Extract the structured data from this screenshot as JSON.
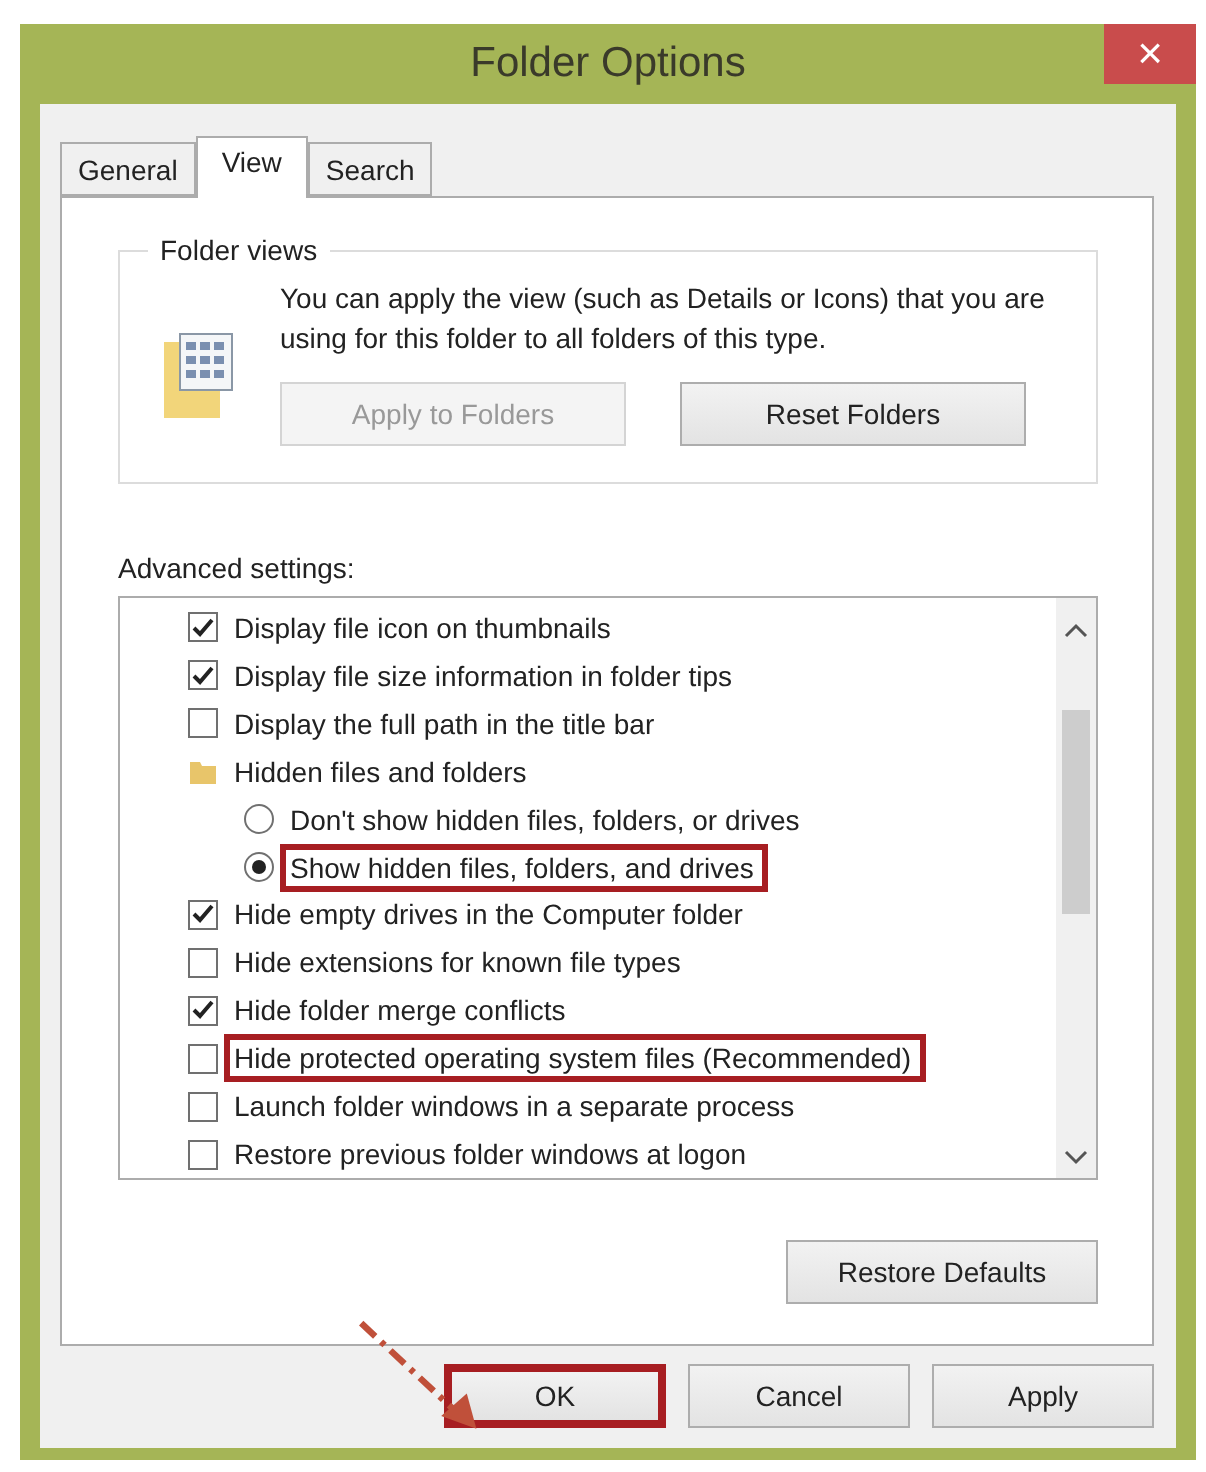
{
  "window": {
    "title": "Folder Options",
    "close": "×"
  },
  "tabs": [
    {
      "label": "General",
      "selected": false
    },
    {
      "label": "View",
      "selected": true
    },
    {
      "label": "Search",
      "selected": false
    }
  ],
  "folder_views": {
    "legend": "Folder views",
    "description": "You can apply the view (such as Details or Icons) that you are using for this folder to all folders of this type.",
    "buttons": [
      {
        "label": "Apply to Folders",
        "disabled": true
      },
      {
        "label": "Reset Folders",
        "disabled": false
      }
    ]
  },
  "advanced": {
    "label": "Advanced settings:",
    "items": [
      {
        "kind": "checkbox",
        "label": "Display file icon on thumbnails",
        "checked": true,
        "highlighted": false
      },
      {
        "kind": "checkbox",
        "label": "Display file size information in folder tips",
        "checked": true,
        "highlighted": false
      },
      {
        "kind": "checkbox",
        "label": "Display the full path in the title bar",
        "checked": false,
        "highlighted": false
      },
      {
        "kind": "group",
        "label": "Hidden files and folders",
        "highlighted": false,
        "children": [
          {
            "kind": "radio",
            "label": "Don't show hidden files, folders, or drives",
            "selected": false,
            "highlighted": false
          },
          {
            "kind": "radio",
            "label": "Show hidden files, folders, and drives",
            "selected": true,
            "highlighted": true
          }
        ]
      },
      {
        "kind": "checkbox",
        "label": "Hide empty drives in the Computer folder",
        "checked": true,
        "highlighted": false
      },
      {
        "kind": "checkbox",
        "label": "Hide extensions for known file types",
        "checked": false,
        "highlighted": false
      },
      {
        "kind": "checkbox",
        "label": "Hide folder merge conflicts",
        "checked": true,
        "highlighted": false
      },
      {
        "kind": "checkbox",
        "label": "Hide protected operating system files (Recommended)",
        "checked": false,
        "highlighted": true
      },
      {
        "kind": "checkbox",
        "label": "Launch folder windows in a separate process",
        "checked": false,
        "highlighted": false
      },
      {
        "kind": "checkbox",
        "label": "Restore previous folder windows at logon",
        "checked": false,
        "highlighted": false
      }
    ],
    "restore_button": "Restore Defaults"
  },
  "buttons": [
    {
      "label": "OK",
      "highlighted": true
    },
    {
      "label": "Cancel",
      "highlighted": false
    },
    {
      "label": "Apply",
      "highlighted": false
    }
  ]
}
